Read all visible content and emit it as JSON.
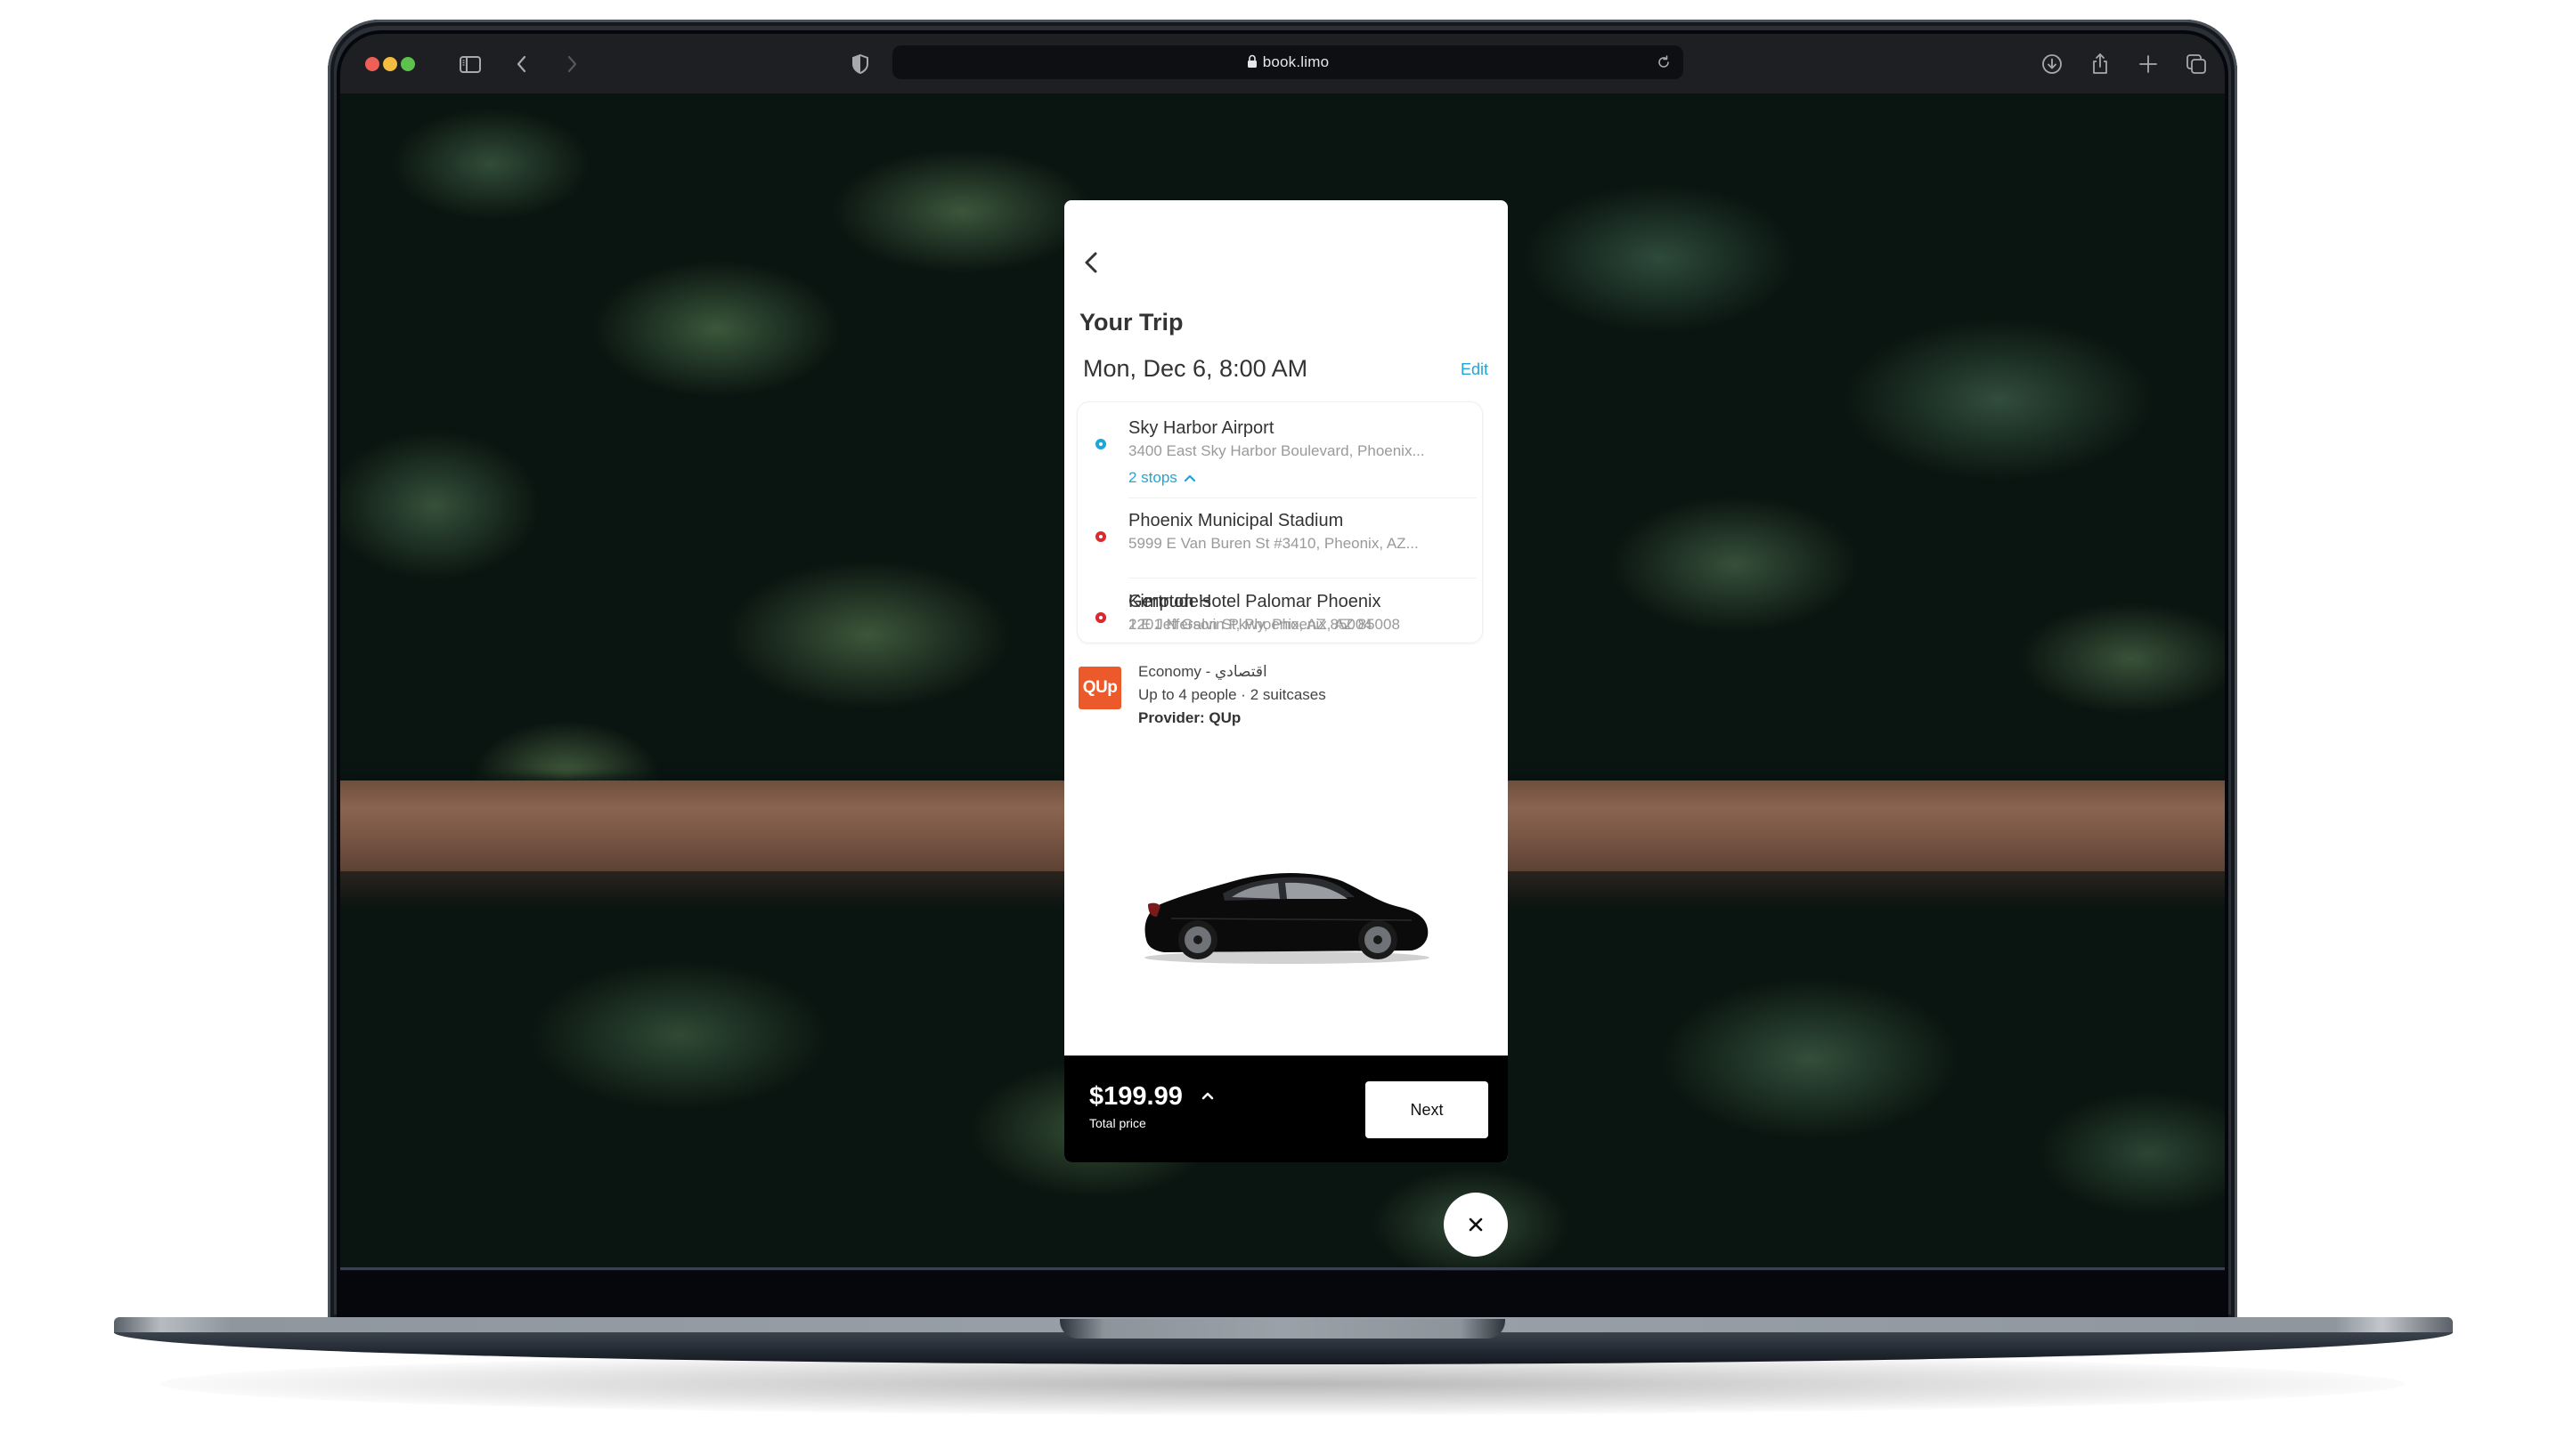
{
  "browser": {
    "url": "book.limo",
    "icons": {
      "sidebar": "sidebar-icon",
      "back": "chevron-left-icon",
      "forward": "chevron-right-icon",
      "privacy": "shield-icon",
      "lock": "lock-icon",
      "reload": "reload-icon",
      "download": "download-icon",
      "share": "share-icon",
      "new_tab": "plus-icon",
      "tabs": "tabs-overview-icon"
    }
  },
  "trip": {
    "title": "Your Trip",
    "datetime": "Mon, Dec 6, 8:00 AM",
    "edit_label": "Edit",
    "pickup": {
      "name": "Sky Harbor Airport",
      "address": "3400 East Sky Harbor Boulevard, Phoenix..."
    },
    "stops_toggle_label": "2 stops",
    "stops": [
      {
        "name": "Phoenix Municipal Stadium",
        "address": "5999 E Van Buren St #3410, Pheonix, AZ..."
      },
      {
        "name": "Gertrude’s",
        "address": "1201 N Galvin Pkwy, Phoenix, AZ 85008"
      }
    ],
    "dropoff": {
      "name": "Kimpton Hotel Palomar Phoenix",
      "address": "2 E Jefferson St, Phoenix, AZ 85004"
    },
    "colors": {
      "accent": "#1fa5d6",
      "pickup_marker": "#1fa5d6",
      "stop_marker": "#d82a2f",
      "provider_brand": "#ec5a2b"
    }
  },
  "vehicle": {
    "provider_logo_text": "QUp",
    "class_label": "Economy - اقتصادي",
    "capacity": "Up to 4 people · 2 suitcases",
    "provider": "Provider: QUp",
    "image": "black-sedan-car"
  },
  "footer": {
    "price": "$199.99",
    "price_label": "Total price",
    "next_label": "Next"
  }
}
